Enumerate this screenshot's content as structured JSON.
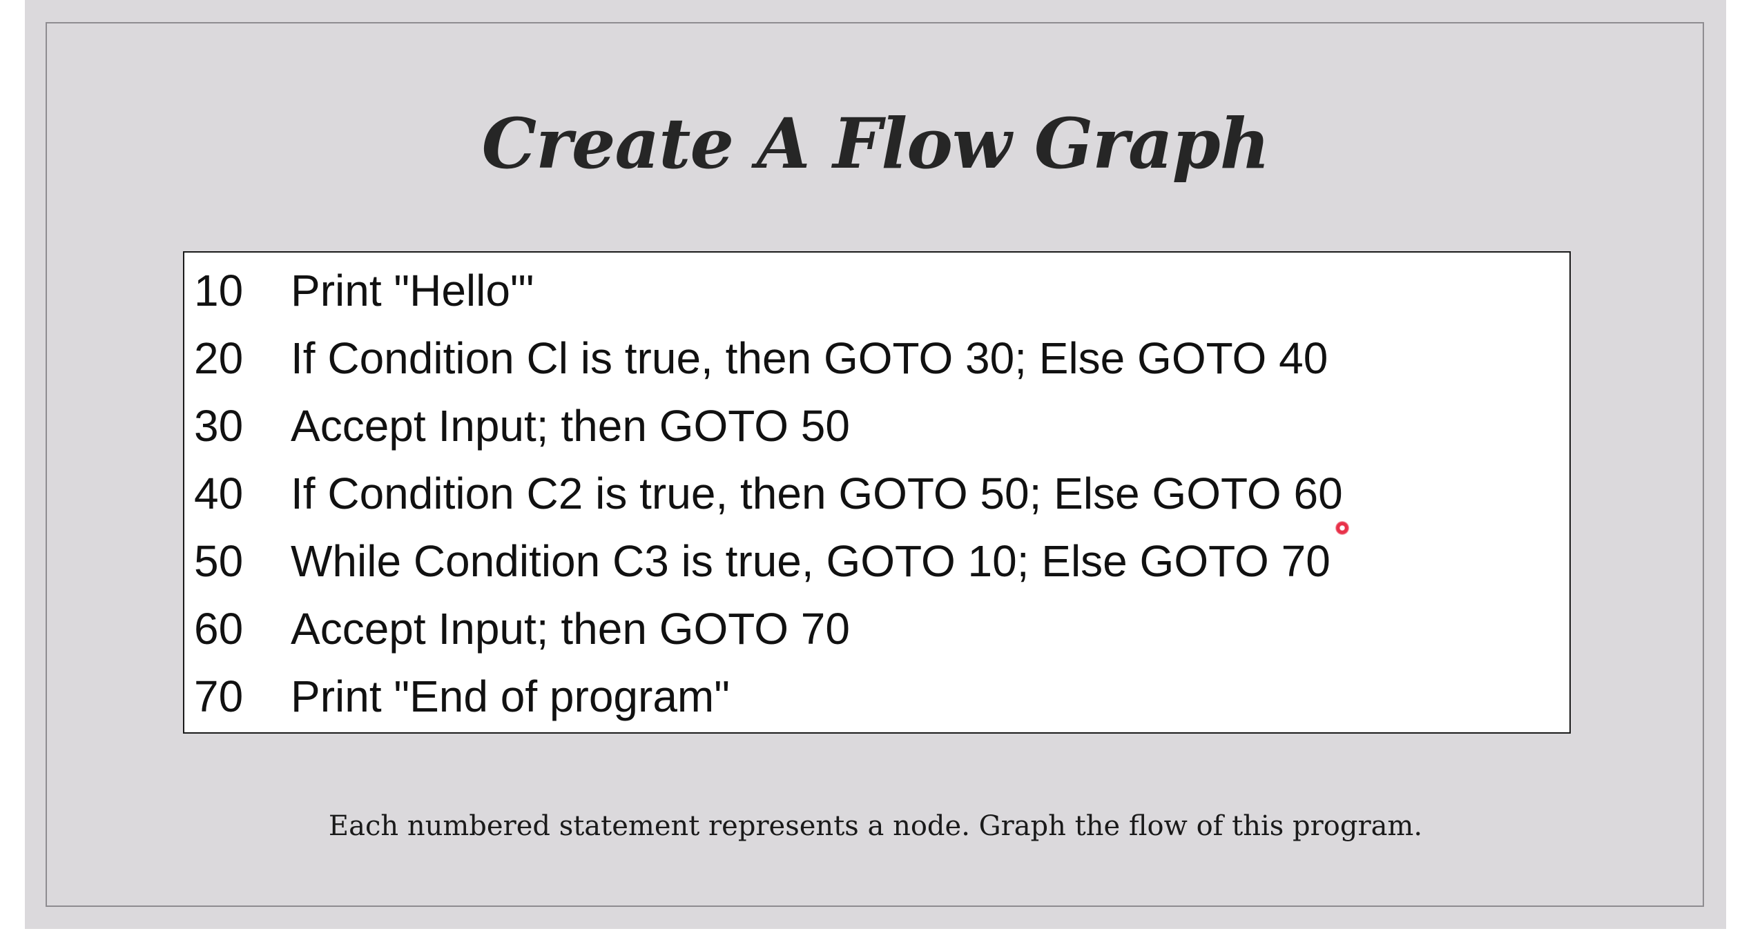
{
  "slide": {
    "title": "Create A Flow Graph",
    "caption": "Each numbered statement represents a node. Graph the flow of this program.",
    "background_color": "#dbd9dc",
    "pointer_color": "#e8324a"
  },
  "code": {
    "lines": [
      {
        "num": "10",
        "text": "Print \"Hello\"'"
      },
      {
        "num": "20",
        "text": "If Condition Cl is true, then GOTO 30; Else GOTO 40"
      },
      {
        "num": "30",
        "text": "Accept Input; then GOTO 50"
      },
      {
        "num": "40",
        "text": "If Condition C2 is true, then GOTO 50; Else GOTO 60"
      },
      {
        "num": "50",
        "text": "While Condition C3 is true, GOTO 10; Else GOTO 70"
      },
      {
        "num": "60",
        "text": "Accept Input; then GOTO 70"
      },
      {
        "num": "70",
        "text": "Print \"End of program\""
      }
    ]
  }
}
